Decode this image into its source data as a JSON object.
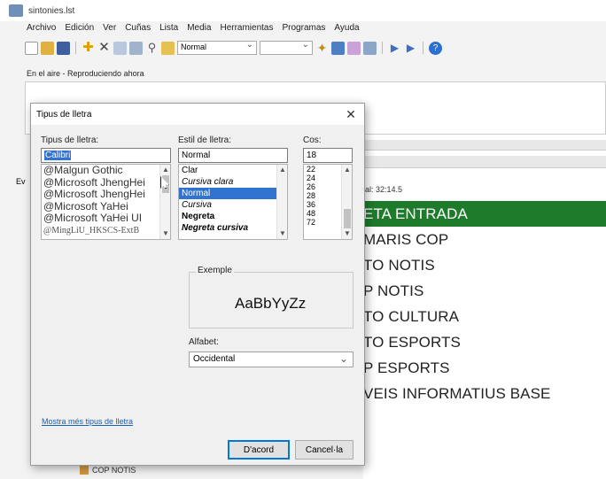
{
  "window": {
    "title": "sintonies.lst"
  },
  "menu": [
    "Archivo",
    "Edición",
    "Ver",
    "Cuñas",
    "Lista",
    "Media",
    "Herramientas",
    "Programas",
    "Ayuda"
  ],
  "toolbar": {
    "style_combo": "Normal"
  },
  "onair": {
    "label": "En el aire - Reproduciendo ahora"
  },
  "playlist": {
    "total_label": "al: 32:14.5",
    "items": [
      "ETA ENTRADA",
      "MARIS COP",
      "TO NOTIS",
      "P NOTIS",
      "TO CULTURA",
      "TO ESPORTS",
      "P ESPORTS",
      "VEIS INFORMATIUS BASE"
    ],
    "active_index": 0,
    "bottom_item": "COP NOTIS",
    "edge_text": "Ev"
  },
  "dialog": {
    "title": "Tipus de lletra",
    "close_glyph": "✕",
    "font_label": "Tipus de lletra:",
    "style_label": "Estil de lletra:",
    "size_label": "Cos:",
    "font_value": "Calibri",
    "style_value": "Normal",
    "size_value": "18",
    "fonts": [
      "@Malgun Gothic",
      "@Microsoft JhengHei",
      "@Microsoft JhengHei",
      "@Microsoft YaHei",
      "@Microsoft YaHei UI",
      "@MingLiU_HKSCS-ExtB"
    ],
    "styles": [
      "Clar",
      "Cursiva clara",
      "Normal",
      "Cursiva",
      "Negreta",
      "Negreta cursiva"
    ],
    "selected_style_index": 2,
    "sizes": [
      "22",
      "24",
      "26",
      "28",
      "36",
      "48",
      "72"
    ],
    "sample_label": "Exemple",
    "sample_text": "AaBbYyZz",
    "charset_label": "Alfabet:",
    "charset_value": "Occidental",
    "more_fonts_link": "Mostra més tipus de lletra",
    "ok_button": "D'acord",
    "cancel_button": "Cancel·la"
  },
  "colors": {
    "active_row": "#1e7b2c",
    "selection": "#3173cf",
    "link": "#1a5fb4"
  }
}
